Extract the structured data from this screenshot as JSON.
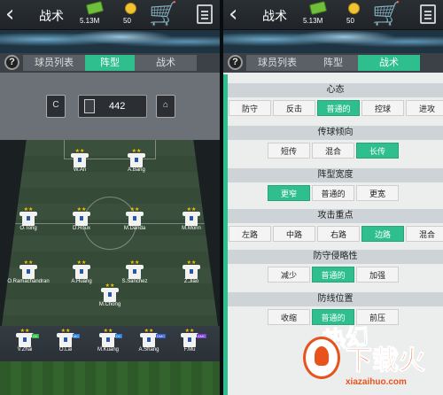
{
  "header": {
    "back_glyph": "‹",
    "title": "战术",
    "money": "5.13M",
    "coins": "50",
    "cart_icon": "shopping-cart-icon",
    "clipboard_icon": "clipboard-icon"
  },
  "tabs": {
    "help": "?",
    "roster": "球员列表",
    "formation": "阵型",
    "tactics": "战术"
  },
  "formation": {
    "captain_icon": "C",
    "value": "442",
    "kit_icon": "kit-icon"
  },
  "players": [
    {
      "name": "W.An",
      "stars": "★★",
      "pos": ""
    },
    {
      "name": "A.Bang",
      "stars": "★★",
      "pos": ""
    },
    {
      "name": "O.Tong",
      "stars": "★★",
      "pos": ""
    },
    {
      "name": "D.Roux",
      "stars": "★★",
      "pos": ""
    },
    {
      "name": "M.Danda",
      "stars": "★★",
      "pos": ""
    },
    {
      "name": "M.Morin",
      "stars": "★★",
      "pos": ""
    },
    {
      "name": "O.Ramachandran",
      "stars": "★★",
      "pos": ""
    },
    {
      "name": "A.Huang",
      "stars": "★★",
      "pos": ""
    },
    {
      "name": "S.Sanchez",
      "stars": "★★",
      "pos": ""
    },
    {
      "name": "Z.Jiao",
      "stars": "★★",
      "pos": ""
    },
    {
      "name": "M.Chong",
      "stars": "★★",
      "pos": ""
    }
  ],
  "bench": [
    {
      "name": "V.Zhai",
      "stars": "★★",
      "pos": "GK"
    },
    {
      "name": "O.Lai",
      "stars": "★★",
      "pos": "MC"
    },
    {
      "name": "M.Kuang",
      "stars": "★★",
      "pos": "DC"
    },
    {
      "name": "A.Shang",
      "stars": "★★",
      "pos": "DMC"
    },
    {
      "name": "F.Mu",
      "stars": "★★",
      "pos": "AMC"
    }
  ],
  "tactics": {
    "mentality": {
      "title": "心态",
      "options": [
        "防守",
        "反击",
        "普通的",
        "控球",
        "进攻"
      ],
      "selected": 2
    },
    "passing": {
      "title": "传球倾向",
      "options": [
        "短传",
        "混合",
        "长传"
      ],
      "selected": 2
    },
    "width": {
      "title": "阵型宽度",
      "options": [
        "更窄",
        "普通的",
        "更宽"
      ],
      "selected": 0
    },
    "focus": {
      "title": "攻击重点",
      "options": [
        "左路",
        "中路",
        "右路",
        "边路",
        "混合"
      ],
      "selected": 3
    },
    "pressing": {
      "title": "防守侵略性",
      "options": [
        "减少",
        "普通的",
        "加强"
      ],
      "selected": 1
    },
    "defline": {
      "title": "防线位置",
      "options": [
        "收缩",
        "普通的",
        "前压"
      ],
      "selected": 1
    }
  },
  "watermark": {
    "game_logo": "热幻",
    "site_name": "下载火",
    "url": "xiazaihuo.com"
  }
}
